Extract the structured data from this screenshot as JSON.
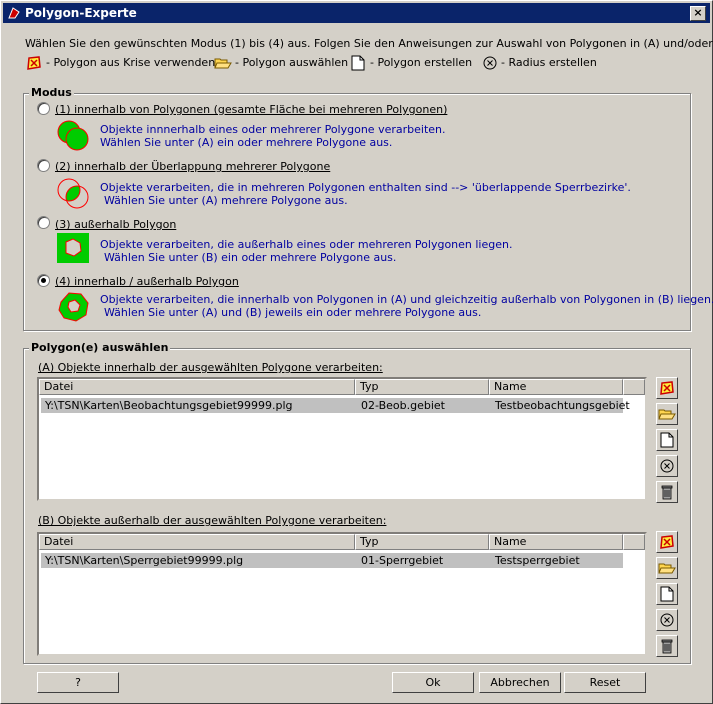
{
  "window": {
    "title": "Polygon-Experte",
    "close_label": "×"
  },
  "intro": "Wählen Sie den gewünschten Modus (1) bis (4) aus. Folgen Sie den Anweisungen zur  Auswahl von Polygonen in (A) und/oder (B) ...",
  "legend": {
    "crisis": "- Polygon aus Krise verwenden",
    "select": "- Polygon auswählen",
    "create": "- Polygon erstellen",
    "radius": "- Radius erstellen"
  },
  "modus": {
    "title": "Modus",
    "options": [
      {
        "label": "(1) innerhalb von Polygonen (gesamte Fläche bei mehreren Polygonen)",
        "line1": "Objekte innnerhalb eines oder mehrerer Polygone verarbeiten.",
        "line2": "Wählen Sie unter (A) ein oder mehrere Polygone aus.",
        "checked": false
      },
      {
        "label": "(2) innerhalb der Überlappung mehrerer Polygone",
        "line1": "Objekte verarbeiten, die in mehreren Polygonen enthalten sind --> 'überlappende Sperrbezirke'.",
        "line2": "Wählen Sie unter (A) mehrere Polygone aus.",
        "checked": false
      },
      {
        "label": "(3) außerhalb Polygon",
        "line1": "Objekte verarbeiten, die außerhalb eines oder mehreren Polygonen liegen.",
        "line2": "Wählen Sie unter (B) ein oder mehrere Polygone aus.",
        "checked": false
      },
      {
        "label": "(4) innerhalb / außerhalb Polygon",
        "line1": "Objekte verarbeiten, die innerhalb von Polygonen in (A) und gleichzeitig außerhalb von Polygonen in (B) liegen.",
        "line2": "Wählen Sie unter (A) und (B) jeweils ein oder mehrere Polygone aus.",
        "checked": true
      }
    ]
  },
  "select": {
    "title": "Polygon(e) auswählen",
    "a_label": "(A) Objekte innerhalb der ausgewählten Polygone verarbeiten:",
    "b_label": "(B) Objekte außerhalb der ausgewählten Polygone verarbeiten:",
    "columns": [
      "Datei",
      "Typ",
      "Name"
    ],
    "a_rows": [
      {
        "file": "Y:\\TSN\\Karten\\Beobachtungsgebiet99999.plg",
        "type": "02-Beob.gebiet",
        "name": "Testbeobachtungsgebiet"
      }
    ],
    "b_rows": [
      {
        "file": "Y:\\TSN\\Karten\\Sperrgebiet99999.plg",
        "type": "01-Sperrgebiet",
        "name": "Testsperrgebiet"
      }
    ]
  },
  "buttons": {
    "help": "?",
    "ok": "Ok",
    "cancel": "Abbrechen",
    "reset": "Reset"
  },
  "colors": {
    "title_bg": "#0a246a",
    "polygon_green": "#00cc00",
    "polygon_red": "#ff0000",
    "text_blue": "#0000a0"
  }
}
